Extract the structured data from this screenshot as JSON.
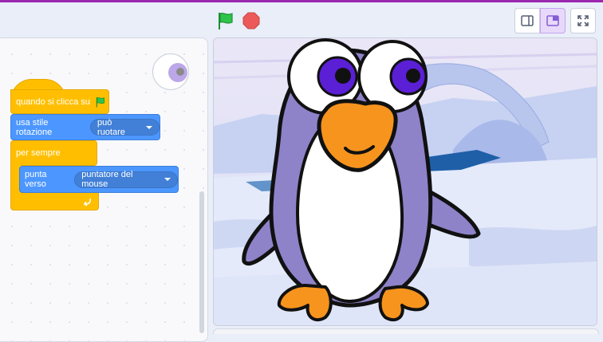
{
  "header": {
    "green_flag_icon": "green-flag-icon",
    "stop_icon": "stop-icon",
    "stage_modes": [
      "small-stage-icon",
      "normal-stage-icon",
      "fullscreen-icon"
    ]
  },
  "code": {
    "hat_label": "quando si clicca su",
    "rotation_label": "usa stile rotazione",
    "rotation_value": "può ruotare",
    "forever_label": "per sempre",
    "point_label": "punta verso",
    "point_value": "puntatore del mouse"
  },
  "colors": {
    "accent": "#9c27b0",
    "events": "#ffbf00",
    "motion": "#4c97ff",
    "flag": "#2ec44a",
    "stop": "#ec5959"
  },
  "stage": {
    "sprite": "penguin",
    "backdrop": "arctic"
  }
}
